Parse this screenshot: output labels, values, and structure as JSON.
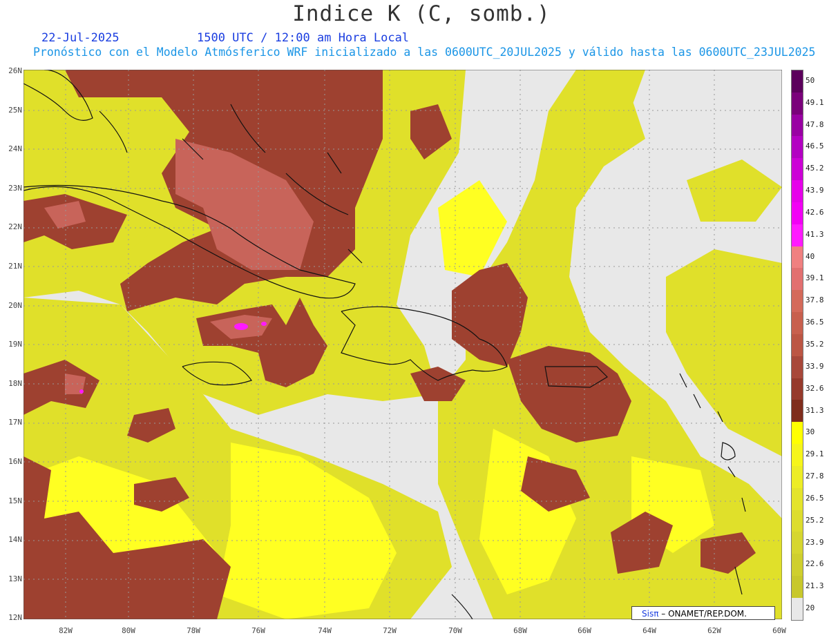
{
  "header": {
    "title": "Indice K (C, somb.)",
    "date": "22-Jul-2025",
    "time": "1500 UTC / 12:00 am Hora Local",
    "description": "Pronóstico con el Modelo Atmósferico WRF inicializado a las 0600UTC_20JUL2025 y válido hasta las  0600UTC_23JUL2025"
  },
  "map": {
    "lat_labels": [
      "26N",
      "25N",
      "24N",
      "23N",
      "22N",
      "21N",
      "20N",
      "19N",
      "18N",
      "17N",
      "16N",
      "15N",
      "14N",
      "13N",
      "12N"
    ],
    "lon_labels": [
      "82W",
      "80W",
      "78W",
      "76W",
      "74W",
      "72W",
      "70W",
      "68W",
      "66W",
      "64W",
      "62W",
      "60W"
    ]
  },
  "colorbar": {
    "labels": [
      "50",
      "49.1",
      "47.8",
      "46.5",
      "45.2",
      "43.9",
      "42.6",
      "41.3",
      "40",
      "39.1",
      "37.8",
      "36.5",
      "35.2",
      "33.9",
      "32.6",
      "31.3",
      "30",
      "29.1",
      "27.8",
      "26.5",
      "25.2",
      "23.9",
      "22.6",
      "21.3",
      "20"
    ],
    "colors": [
      "#5c005c",
      "#7a007a",
      "#9900a3",
      "#b300c2",
      "#cc00d6",
      "#e600ea",
      "#f200f5",
      "#ff1aff",
      "#f08080",
      "#e27070",
      "#d46a5a",
      "#c8604e",
      "#bc5644",
      "#a8483a",
      "#963a2c",
      "#7f2d1c",
      "#ffff00",
      "#f6f51a",
      "#eded26",
      "#e4e42c",
      "#dddd2e",
      "#d6d630",
      "#cfcf2e",
      "#c8c82c",
      "#e8e8e8"
    ]
  },
  "credit": {
    "brand": "Sisπ",
    "text": "– ONAMET/REP.DOM."
  }
}
